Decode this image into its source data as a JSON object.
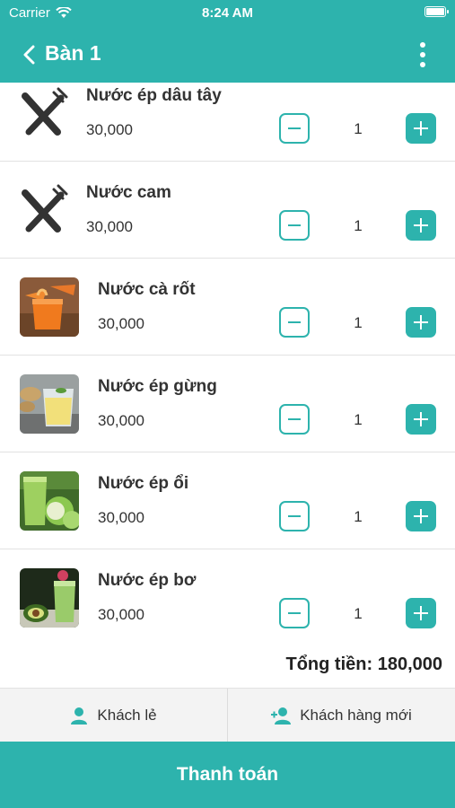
{
  "status_bar": {
    "carrier": "Carrier",
    "time": "8:24 AM"
  },
  "nav": {
    "title": "Bàn 1",
    "back_icon": "chevron-left-icon",
    "more_icon": "vertical-dots-icon"
  },
  "items": [
    {
      "name": "Nước ép dâu tây",
      "price": "30,000",
      "quantity": "1",
      "image": "utensils-icon"
    },
    {
      "name": "Nước cam",
      "price": "30,000",
      "quantity": "1",
      "image": "utensils-icon"
    },
    {
      "name": "Nước cà rốt",
      "price": "30,000",
      "quantity": "1",
      "image": "carrot-juice-photo"
    },
    {
      "name": "Nước ép gừng",
      "price": "30,000",
      "quantity": "1",
      "image": "ginger-juice-photo"
    },
    {
      "name": "Nước ép ổi",
      "price": "30,000",
      "quantity": "1",
      "image": "guava-juice-photo"
    },
    {
      "name": "Nước ép bơ",
      "price": "30,000",
      "quantity": "1",
      "image": "avocado-juice-photo"
    }
  ],
  "total": {
    "text": "Tổng tiền: 180,000"
  },
  "customer": {
    "walk_in_label": "Khách lẻ",
    "new_customer_label": "Khách hàng mới"
  },
  "checkout": {
    "label": "Thanh toán"
  },
  "colors": {
    "accent": "#2db3ad"
  }
}
